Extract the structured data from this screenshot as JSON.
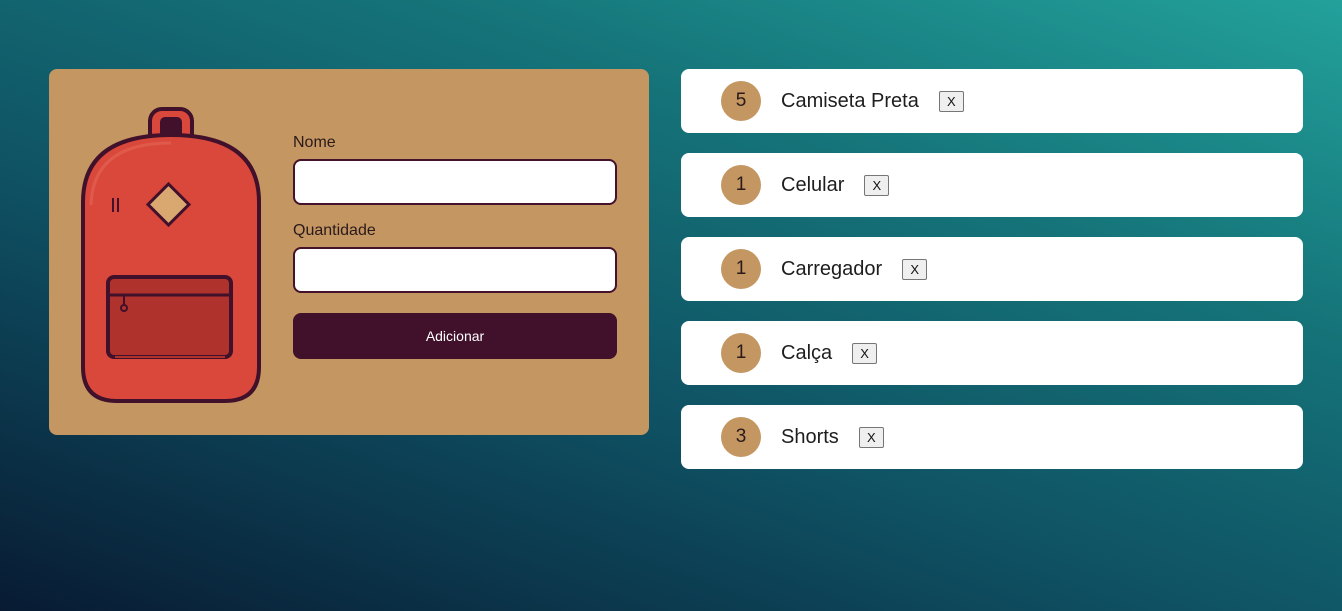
{
  "form": {
    "name_label": "Nome",
    "name_value": "",
    "quantity_label": "Quantidade",
    "quantity_value": "",
    "submit_label": "Adicionar"
  },
  "illustration": {
    "icon": "backpack-icon"
  },
  "items": [
    {
      "quantity": "5",
      "name": "Camiseta Preta",
      "remove_label": "X"
    },
    {
      "quantity": "1",
      "name": "Celular",
      "remove_label": "X"
    },
    {
      "quantity": "1",
      "name": "Carregador",
      "remove_label": "X"
    },
    {
      "quantity": "1",
      "name": "Calça",
      "remove_label": "X"
    },
    {
      "quantity": "3",
      "name": "Shorts",
      "remove_label": "X"
    }
  ],
  "colors": {
    "card": "#c49662",
    "accent": "#41102a",
    "backpack": "#d9483b",
    "pocket": "#b0322d",
    "diamond": "#d9a871"
  }
}
